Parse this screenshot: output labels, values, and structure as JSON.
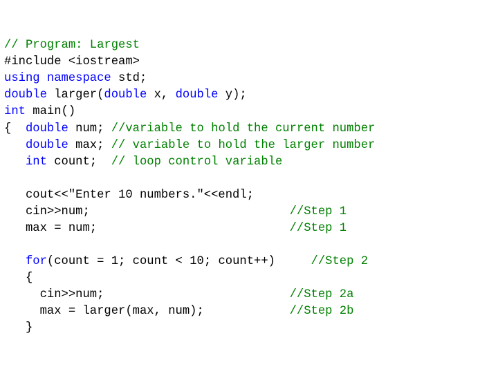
{
  "code": {
    "l1_comment": "// Program: Largest",
    "l2_pre": "#include <",
    "l2_hdr": "iostream",
    "l2_post": ">",
    "l3_a": "using",
    "l3_b": " ",
    "l3_c": "namespace",
    "l3_d": " std;",
    "l4_a": "double",
    "l4_b": " larger(",
    "l4_c": "double",
    "l4_d": " x, ",
    "l4_e": "double",
    "l4_f": " y);",
    "l5_a": "int",
    "l5_b": " main()",
    "l6_a": "{  ",
    "l6_b": "double",
    "l6_c": " num; ",
    "l6_d": "//variable to hold the current number",
    "l7_a": "   ",
    "l7_b": "double",
    "l7_c": " max; ",
    "l7_d": "// variable to hold the larger number",
    "l8_a": "   ",
    "l8_b": "int",
    "l8_c": " count;  ",
    "l8_d": "// loop control variable",
    "blank1": "",
    "l10": "   cout<<\"Enter 10 numbers.\"<<endl;",
    "l11_a": "   cin>>num;                            ",
    "l11_b": "//Step 1",
    "l12_a": "   max = num;                           ",
    "l12_b": "//Step 1",
    "blank2": "",
    "l14_a": "   ",
    "l14_b": "for",
    "l14_c": "(count = 1; count < 10; count++)     ",
    "l14_d": "//Step 2",
    "l15": "   {",
    "l16_a": "     cin>>num;                          ",
    "l16_b": "//Step 2a",
    "l17_a": "     max = larger(max, num);            ",
    "l17_b": "//Step 2b",
    "l18": "   }"
  }
}
